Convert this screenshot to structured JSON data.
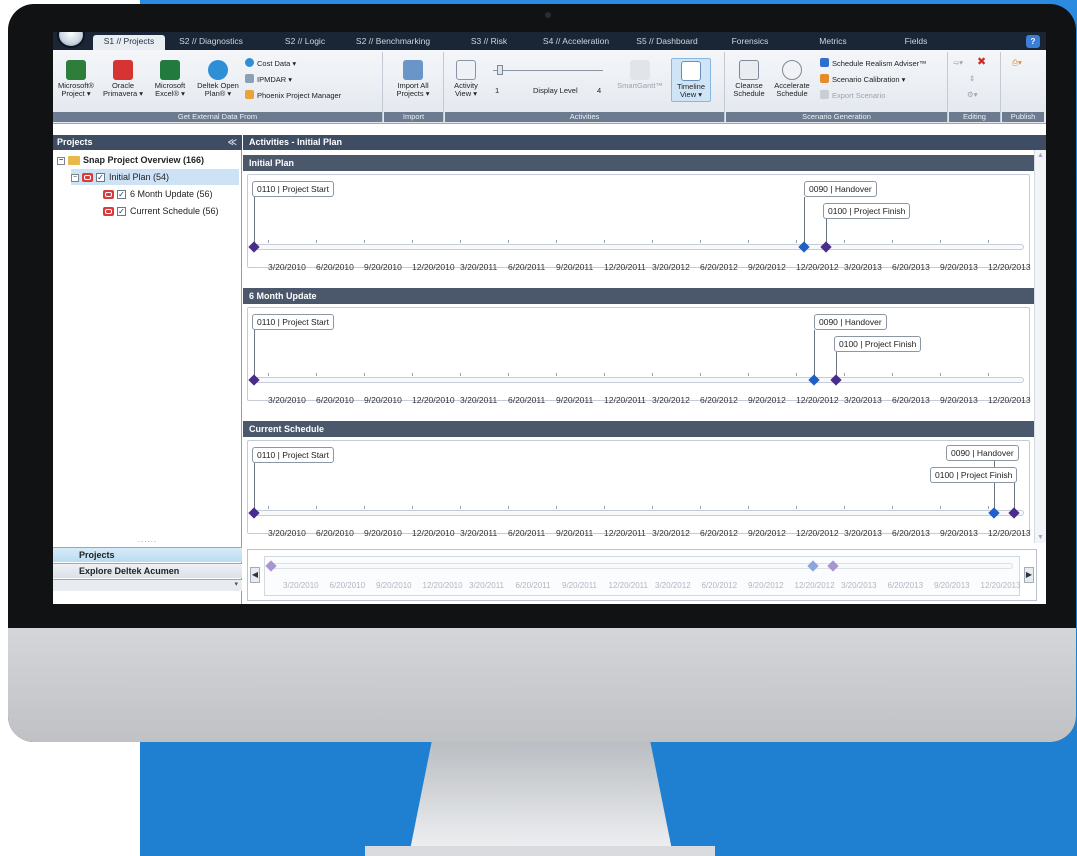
{
  "tabs": [
    {
      "label": "S1 // Projects",
      "active": true
    },
    {
      "label": "S2 // Diagnostics"
    },
    {
      "label": "S2 // Logic"
    },
    {
      "label": "S2 // Benchmarking"
    },
    {
      "label": "S3 // Risk"
    },
    {
      "label": "S4 // Acceleration"
    },
    {
      "label": "S5 // Dashboard"
    },
    {
      "label": "Forensics"
    },
    {
      "label": "Metrics"
    },
    {
      "label": "Fields"
    }
  ],
  "help_label": "?",
  "ribbon": {
    "external": {
      "label": "Get External Data From",
      "msproject": "Microsoft® Project ▾",
      "primavera": "Oracle Primavera ▾",
      "excel": "Microsoft Excel® ▾",
      "deltek": "Deltek Open Plan® ▾",
      "cost_data": "Cost Data ▾",
      "ipmdar": "IPMDAR ▾",
      "phoenix": "Phoenix Project Manager"
    },
    "import": {
      "label": "Import",
      "import_all": "Import All Projects ▾"
    },
    "activities": {
      "label": "Activities",
      "activity_view": "Activity View ▾",
      "slider_min": "1",
      "display_level": "Display Level",
      "slider_max": "4",
      "smartgantt": "SmartGantt™",
      "timeline_view": "Timeline View ▾"
    },
    "scenario": {
      "label": "Scenario Generation",
      "cleanse": "Cleanse Schedule",
      "accelerate": "Accelerate Schedule",
      "realism": "Schedule Realism Adviser™",
      "calibration": "Scenario Calibration ▾",
      "export": "Export Scenario"
    },
    "editing": {
      "label": "Editing"
    },
    "publish": {
      "label": "Publish"
    }
  },
  "left_panel": {
    "title": "Projects",
    "collapse": "≪",
    "tree": {
      "root": "Snap Project Overview (166)",
      "items": [
        "Initial  Plan (54)",
        "6 Month Update (56)",
        "Current Schedule (56)"
      ]
    },
    "splitter": "......",
    "nav": [
      "Projects",
      "Explore Deltek Acumen"
    ],
    "foot_arrow": "▾"
  },
  "main": {
    "title": "Activities - Initial  Plan",
    "sections": [
      {
        "title": "Initial  Plan",
        "start": "0110 | Project Start",
        "handover": "0090 | Handover",
        "finish": "0100 | Project Finish"
      },
      {
        "title": "6 Month Update",
        "start": "0110 | Project Start",
        "handover": "0090 | Handover",
        "finish": "0100 | Project Finish"
      },
      {
        "title": "Current Schedule",
        "start": "0110 | Project Start",
        "handover": "0090 | Handover",
        "finish": "0100 | Project Finish"
      }
    ],
    "axis_labels": [
      "3/20/2010",
      "6/20/2010",
      "9/20/2010",
      "12/20/2010",
      "3/20/2011",
      "6/20/2011",
      "9/20/2011",
      "12/20/2011",
      "3/20/2012",
      "6/20/2012",
      "9/20/2012",
      "12/20/2012",
      "3/20/2013",
      "6/20/2013",
      "9/20/2013",
      "12/20/2013"
    ],
    "overview_left": "◀",
    "overview_right": "▶"
  },
  "colors": {
    "milestone_purple": "#4a2c8c",
    "milestone_blue": "#1f5fc8",
    "header_dark": "#3e4d63",
    "monitor_backdrop": "#1f7fd0"
  }
}
